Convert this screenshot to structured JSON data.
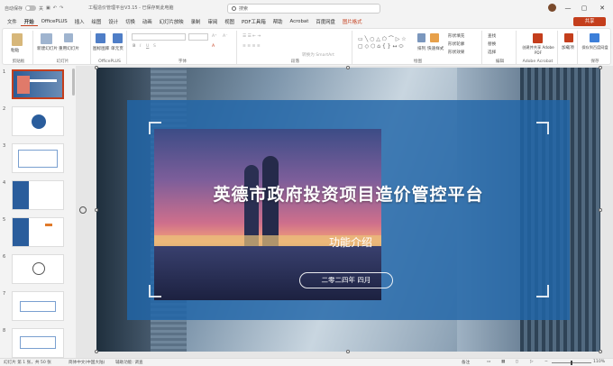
{
  "titlebar": {
    "autosave_label": "自动保存",
    "autosave_state": "关",
    "doc_title": "工程造价管理平台V3.15 - 已保存到此电脑",
    "search_placeholder": "搜索",
    "close_glyph": "✕",
    "minimize_glyph": "—",
    "maximize_glyph": "▢"
  },
  "tabs": [
    "文件",
    "开始",
    "OfficePLUS",
    "插入",
    "绘图",
    "设计",
    "切换",
    "动画",
    "幻灯片放映",
    "录制",
    "审阅",
    "视图",
    "PDF工具箱",
    "帮助",
    "Acrobat",
    "百度网盘",
    "图片格式"
  ],
  "active_tab": "开始",
  "share_label": "共享",
  "ribbon": {
    "groups": [
      {
        "label": "剪贴板",
        "items": [
          "粘贴"
        ]
      },
      {
        "label": "幻灯片",
        "items": [
          "新建幻灯片",
          "重用幻灯片"
        ]
      },
      {
        "label": "OfficePLUS",
        "items": [
          "图标图库",
          "单元页"
        ]
      },
      {
        "label": "字体",
        "items": []
      },
      {
        "label": "段落",
        "items": [
          "转换为 SmartArt"
        ]
      },
      {
        "label": "绘图",
        "items": [
          "排列",
          "快速样式",
          "形状填充",
          "形状轮廓",
          "形状效果"
        ]
      },
      {
        "label": "编辑",
        "items": [
          "查找",
          "替换",
          "选择"
        ]
      },
      {
        "label": "Adobe Acrobat",
        "items": [
          "创建并共享 Adobe PDF"
        ]
      },
      {
        "label": "",
        "items": [
          "加载项"
        ]
      },
      {
        "label": "保存",
        "items": [
          "保存到百度网盘"
        ]
      }
    ]
  },
  "thumbnails": [
    {
      "num": "1",
      "selected": true
    },
    {
      "num": "2",
      "selected": false
    },
    {
      "num": "3",
      "selected": false
    },
    {
      "num": "4",
      "selected": false
    },
    {
      "num": "5",
      "selected": false
    },
    {
      "num": "6",
      "selected": false
    },
    {
      "num": "7",
      "selected": false
    },
    {
      "num": "8",
      "selected": false
    }
  ],
  "slide": {
    "title": "英德市政府投资项目造价管控平台",
    "subtitle": "功能介绍",
    "date": "二零二四年 四月"
  },
  "statusbar": {
    "slide_info": "幻灯片 第 1 张，共 50 张",
    "language": "简体中文(中国大陆)",
    "accessibility": "辅助功能: 调查",
    "notes": "备注",
    "zoom": "110%"
  },
  "colors": {
    "accent": "#c43e1c",
    "band": "#2065a8"
  }
}
